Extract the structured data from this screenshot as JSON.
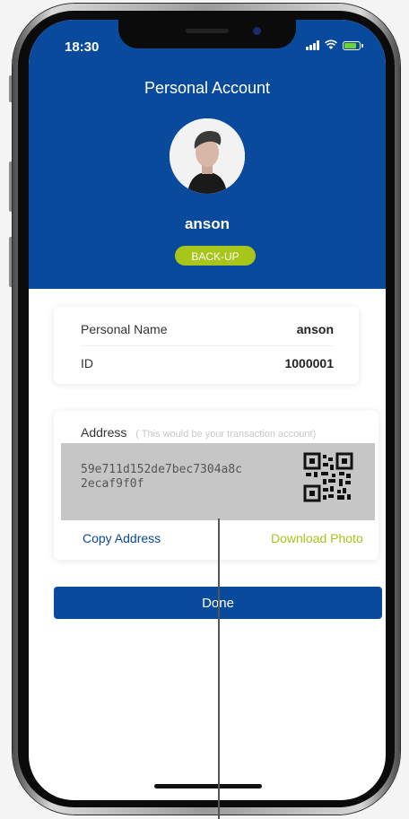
{
  "status_bar": {
    "time": "18:30"
  },
  "header": {
    "title": "Personal Account",
    "user_name": "anson",
    "backup_label": "BACK-UP"
  },
  "info_card": {
    "rows": [
      {
        "label": "Personal Name",
        "value": "anson"
      },
      {
        "label": "ID",
        "value": "1000001"
      }
    ]
  },
  "address_card": {
    "label": "Address",
    "hint": "( This would be your transaction account)",
    "address_line1": "59e711d152de7bec7304a8c",
    "address_line2": "2ecaf9f0f",
    "copy_label": "Copy Address",
    "download_label": "Download Photo"
  },
  "done_label": "Done",
  "colors": {
    "primary": "#0a4a9c",
    "accent": "#a6c61a",
    "address_bg": "#c6c6c6"
  }
}
